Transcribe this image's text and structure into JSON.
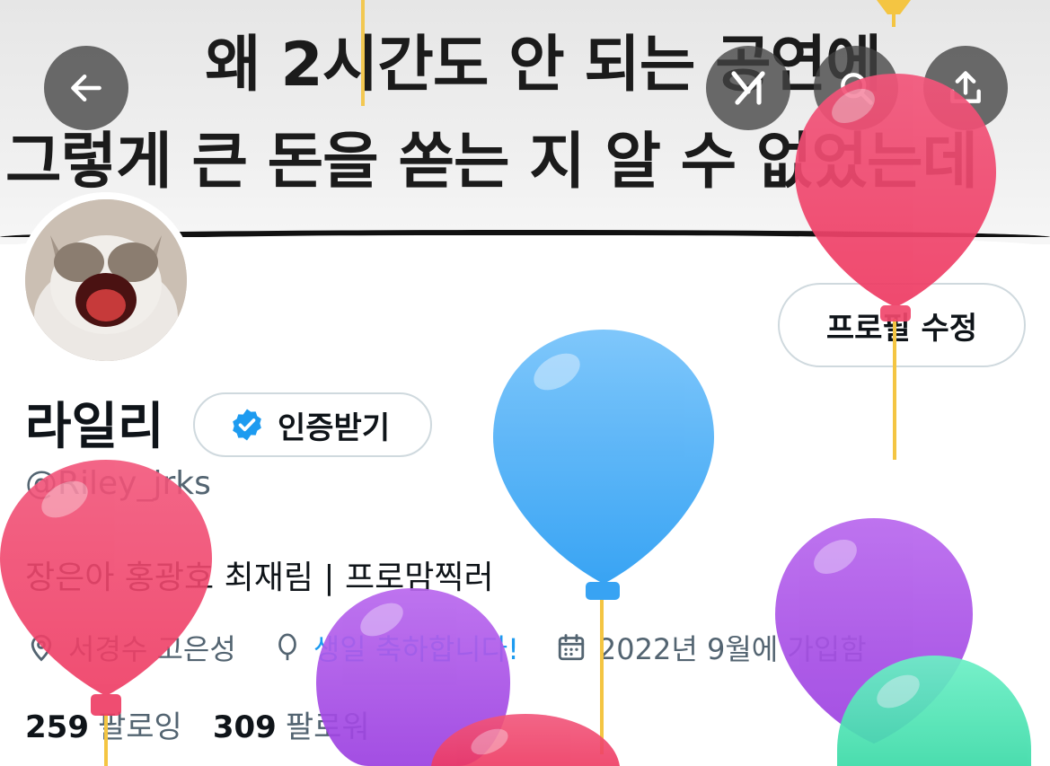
{
  "banner": {
    "line1": "왜 2시간도 안 되는 공연에",
    "line2": "그렇게 큰 돈을 쏟는 지 알 수 없었는데"
  },
  "header_buttons": {
    "back": "arrow-left-icon",
    "grok": "grok-icon",
    "search": "search-icon",
    "share": "share-icon"
  },
  "profile": {
    "display_name": "라일리",
    "verify_label": "인증받기",
    "edit_label": "프로필 수정",
    "handle": "@Riley_jrks",
    "bio": "장은아 홍광호 최재림 | 프로맘찍러",
    "location": "서경수 고은성",
    "birthday": "생일 축하합니다!",
    "joined": "2022년 9월에 가입함",
    "following_count": "259",
    "following_label": "팔로잉",
    "followers_count": "309",
    "followers_label": "팔로워"
  },
  "colors": {
    "accent": "#1d9bf0",
    "muted": "#536471",
    "text": "#0f1419",
    "balloon_red": "#f0476c",
    "balloon_blue": "#47aef6",
    "balloon_purple": "#b24de6",
    "balloon_green": "#4ee6b8"
  }
}
